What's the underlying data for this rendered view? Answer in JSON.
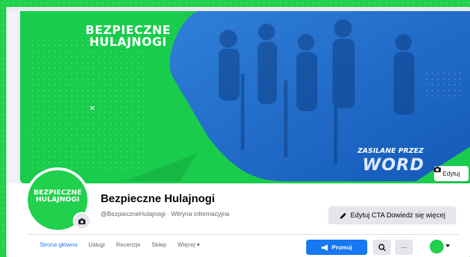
{
  "cover": {
    "logo_line1": "BEZPIECZNE",
    "logo_line2": "HULAJNOGI",
    "powered_line1": "ZASILANE PRZEZ",
    "powered_line2": "WORD",
    "edit_label": "Edytuj",
    "close_icon": "×"
  },
  "profile": {
    "avatar_line1": "BEZPIECZNE",
    "avatar_line2": "HULAJNOGI",
    "name": "Bezpieczne Hulajnogi",
    "meta": "@BezpieczneHulajnogi · Witryna informacyjna",
    "cta_label": "Edytuj CTA Dowiedz się więcej"
  },
  "tabs": [
    {
      "label": "Strona główna",
      "active": true
    },
    {
      "label": "Usługi"
    },
    {
      "label": "Recenzje"
    },
    {
      "label": "Sklep"
    },
    {
      "label": "Więcej ▾"
    }
  ],
  "actions": {
    "promote_label": "Promuj",
    "more_label": "···"
  },
  "colors": {
    "brand_green": "#22d14a",
    "fb_blue": "#1877f2",
    "cover_blue": "#1e6fd9"
  }
}
